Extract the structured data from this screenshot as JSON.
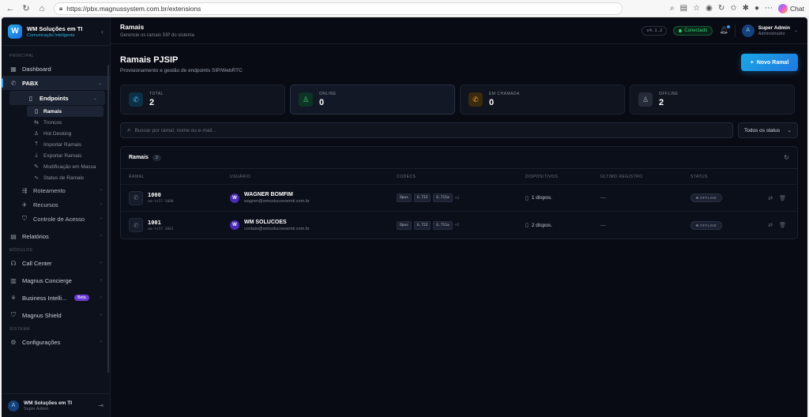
{
  "browser": {
    "url": "https://pbx.magnussystem.com.br/extensions",
    "chat_label": "Chat"
  },
  "brand": {
    "name": "WM Soluções em TI",
    "tagline": "Comunicação Inteligente",
    "logo_letter": "W"
  },
  "sidebar": {
    "sections": {
      "principal": "PRINCIPAL",
      "modulos": "MÓDULOS",
      "sistema": "SISTEMA"
    },
    "items": {
      "dashboard": "Dashboard",
      "pabx": "PABX",
      "endpoints": "Endpoints",
      "ramais": "Ramais",
      "troncos": "Troncos",
      "hot_desking": "Hot Desking",
      "importar": "Importar Ramais",
      "exportar": "Exportar Ramais",
      "modificacao": "Modificação em Massa",
      "status": "Status de Ramais",
      "roteamento": "Roteamento",
      "recursos": "Recursos",
      "controle": "Controle de Acesso",
      "relatorios": "Relatórios",
      "call_center": "Call Center",
      "concierge": "Magnus Concierge",
      "bi": "Business Intelli...",
      "bi_badge": "Beta",
      "shield": "Magnus Shield",
      "config": "Configurações"
    },
    "user": {
      "name": "WM Soluções em TI",
      "role": "Super Admin",
      "avatar_letter": "A"
    }
  },
  "topbar": {
    "title": "Ramais",
    "subtitle": "Gerencie os ramais SIP do sistema",
    "version": "v4.1.2",
    "connection": "Conectado",
    "user_name": "Super Admin",
    "user_role": "Administrador",
    "avatar_letter": "A"
  },
  "page": {
    "title": "Ramais PJSIP",
    "subtitle": "Provisionamento e gestão de endpoints SIP/WebRTC",
    "new_button": "Novo Ramal"
  },
  "stats": {
    "total_label": "TOTAL",
    "total_value": "2",
    "online_label": "ONLINE",
    "online_value": "0",
    "call_label": "EM CHAMADA",
    "call_value": "0",
    "offline_label": "OFFLINE",
    "offline_value": "2"
  },
  "filters": {
    "search_placeholder": "Buscar por ramal, nome ou e-mail...",
    "status_select": "Todos os status"
  },
  "table": {
    "title": "Ramais",
    "count": "2",
    "columns": {
      "ramal": "RAMAL",
      "usuario": "USUÁRIO",
      "codecs": "CODECS",
      "dispositivos": "DISPOSITIVOS",
      "ultimo_registro": "ÚLTIMO REGISTRO",
      "status": "STATUS"
    },
    "rows": [
      {
        "ext": "1000",
        "ext_id": "wm-ts57-1000",
        "avatar": "W",
        "name": "WAGNER BOMFIM",
        "email": "wagner@wmsolucoesemti.com.br",
        "codec1": "Opus",
        "codec2": "G.722",
        "codec3": "G.711a",
        "codec_more": "+1",
        "devices": "1 dispos.",
        "last_reg": "—",
        "status": "OFFLINE"
      },
      {
        "ext": "1001",
        "ext_id": "wm-ts57-1001",
        "avatar": "W",
        "name": "WM SOLUCOES",
        "email": "contato@wmsolucoesemti.com.br",
        "codec1": "Opus",
        "codec2": "G.722",
        "codec3": "G.711a",
        "codec_more": "+1",
        "devices": "2 dispos.",
        "last_reg": "—",
        "status": "OFFLINE"
      }
    ]
  },
  "colors": {
    "accent": "#2c9cf0",
    "online": "#34d27a",
    "call": "#f0a12c",
    "beta": "#6b3bd6"
  }
}
